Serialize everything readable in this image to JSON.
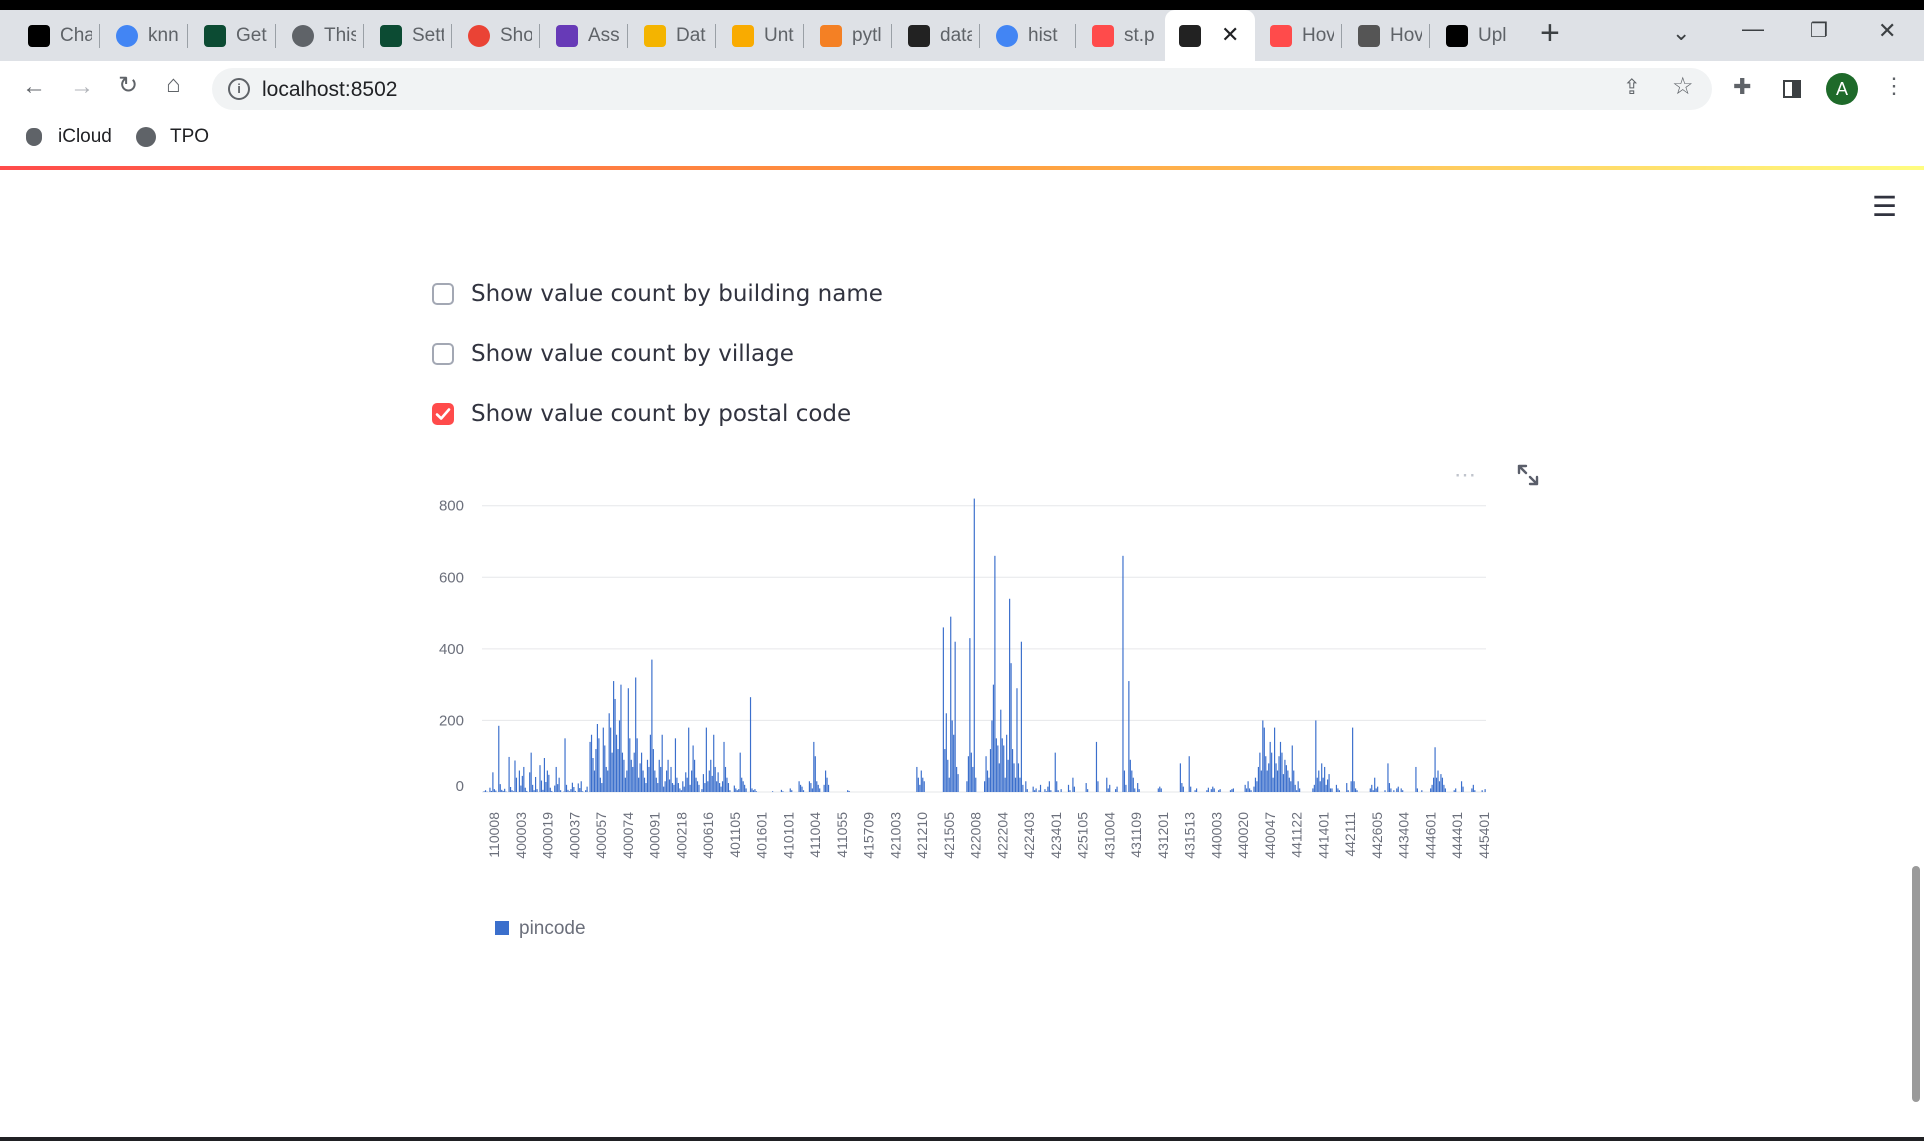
{
  "browser": {
    "tabs": [
      {
        "title": "Cha",
        "icon": "chatgpt-icon",
        "color": "#000000"
      },
      {
        "title": "knn",
        "icon": "google-icon",
        "color": "#4285f4"
      },
      {
        "title": "Get",
        "icon": "django-icon",
        "color": "#0c4b33"
      },
      {
        "title": "This",
        "icon": "globe-icon",
        "color": "#5f6368"
      },
      {
        "title": "Sett",
        "icon": "django-icon",
        "color": "#0c4b33"
      },
      {
        "title": "Sho",
        "icon": "gmail-icon",
        "color": "#ea4335"
      },
      {
        "title": "Ass",
        "icon": "forms-icon",
        "color": "#673ab7"
      },
      {
        "title": "Dat",
        "icon": "folder-icon",
        "color": "#f4b400"
      },
      {
        "title": "Unt",
        "icon": "colab-icon",
        "color": "#f9ab00"
      },
      {
        "title": "pytl",
        "icon": "stackoverflow-icon",
        "color": "#f48024"
      },
      {
        "title": "data",
        "icon": "streamlit-icon",
        "color": "#222222"
      },
      {
        "title": "hist",
        "icon": "google-icon",
        "color": "#4285f4"
      },
      {
        "title": "st.p",
        "icon": "streamlit-icon",
        "color": "#ff4b4b"
      },
      {
        "title": "",
        "icon": "streamlit-icon",
        "color": "#222222",
        "active": true
      },
      {
        "title": "Hov",
        "icon": "streamlit-icon",
        "color": "#ff4b4b"
      },
      {
        "title": "Hov",
        "icon": "avatar-icon",
        "color": "#555555"
      },
      {
        "title": "Upl",
        "icon": "github-icon",
        "color": "#000000"
      }
    ],
    "close_tab_glyph": "✕",
    "new_tab_glyph": "+",
    "url": "localhost:8502",
    "profile_initial": "A",
    "bookmarks": [
      {
        "label": "iCloud",
        "icon": "apple-icon"
      },
      {
        "label": "TPO",
        "icon": "globe-icon"
      }
    ]
  },
  "app": {
    "checkboxes": [
      {
        "label": "Show value count by building name",
        "checked": false
      },
      {
        "label": "Show value count by village",
        "checked": false
      },
      {
        "label": "Show value count by postal code",
        "checked": true
      }
    ],
    "menu_glyph": "☰"
  },
  "chart_data": {
    "type": "bar",
    "series_name": "pincode",
    "color": "#3b6fcc",
    "ylim": [
      0,
      830
    ],
    "yticks": [
      0,
      200,
      400,
      600,
      800
    ],
    "x_tick_labels": [
      "110008",
      "400003",
      "400019",
      "400037",
      "400057",
      "400074",
      "400091",
      "400218",
      "400616",
      "401105",
      "401601",
      "410101",
      "411004",
      "411055",
      "415709",
      "421003",
      "421210",
      "421505",
      "422008",
      "422204",
      "422403",
      "423401",
      "425105",
      "431004",
      "431109",
      "431201",
      "431513",
      "440003",
      "440020",
      "440047",
      "441122",
      "441401",
      "442111",
      "442605",
      "443404",
      "444601",
      "444401",
      "445401"
    ],
    "values": [
      0,
      2,
      5,
      1,
      0,
      12,
      3,
      55,
      8,
      4,
      0,
      185,
      22,
      6,
      3,
      9,
      1,
      0,
      98,
      14,
      5,
      2,
      88,
      40,
      0,
      60,
      18,
      45,
      70,
      12,
      3,
      0,
      55,
      110,
      20,
      5,
      42,
      8,
      0,
      75,
      32,
      6,
      95,
      28,
      60,
      48,
      12,
      3,
      0,
      18,
      70,
      22,
      40,
      5,
      0,
      1,
      150,
      20,
      6,
      2,
      8,
      26,
      14,
      3,
      0,
      24,
      11,
      30,
      2,
      0,
      5,
      15,
      0,
      140,
      160,
      95,
      60,
      120,
      190,
      150,
      40,
      25,
      180,
      130,
      70,
      60,
      220,
      180,
      110,
      310,
      260,
      160,
      120,
      200,
      300,
      110,
      90,
      40,
      60,
      290,
      150,
      90,
      70,
      110,
      320,
      150,
      40,
      80,
      110,
      60,
      40,
      25,
      90,
      70,
      160,
      370,
      120,
      60,
      40,
      25,
      90,
      70,
      160,
      15,
      30,
      60,
      90,
      35,
      70,
      25,
      20,
      150,
      40,
      25,
      10,
      5,
      30,
      15,
      55,
      40,
      180,
      20,
      60,
      130,
      90,
      40,
      30,
      20,
      0,
      8,
      50,
      25,
      180,
      30,
      60,
      90,
      45,
      160,
      70,
      30,
      55,
      25,
      15,
      30,
      140,
      70,
      40,
      25,
      5,
      0,
      0,
      18,
      10,
      5,
      8,
      110,
      40,
      30,
      20,
      10,
      0,
      0,
      265,
      10,
      5,
      8,
      2,
      0,
      0,
      0,
      0,
      0,
      0,
      0,
      0,
      0,
      0,
      2,
      0,
      0,
      0,
      0,
      0,
      6,
      2,
      0,
      0,
      0,
      0,
      10,
      5,
      0,
      0,
      0,
      0,
      30,
      20,
      15,
      5,
      0,
      0,
      0,
      30,
      25,
      10,
      140,
      100,
      30,
      20,
      10,
      0,
      0,
      20,
      60,
      40,
      20,
      0,
      0,
      0,
      0,
      0,
      0,
      0,
      0,
      0,
      0,
      0,
      0,
      5,
      3,
      0,
      0,
      0,
      0,
      0,
      0,
      0,
      0,
      0,
      0,
      0,
      0,
      0,
      0,
      0,
      0,
      0,
      0,
      0,
      0,
      0,
      0,
      0,
      0,
      0,
      0,
      0,
      0,
      0,
      0,
      0,
      0,
      0,
      0,
      0,
      0,
      0,
      0,
      0,
      0,
      0,
      0,
      0,
      0,
      0,
      70,
      40,
      20,
      60,
      40,
      30,
      0,
      0,
      0,
      0,
      0,
      0,
      0,
      0,
      0,
      0,
      0,
      0,
      460,
      120,
      220,
      90,
      40,
      490,
      200,
      160,
      420,
      70,
      50,
      0,
      0,
      0,
      0,
      0,
      30,
      100,
      430,
      110,
      70,
      820,
      40,
      0,
      0,
      0,
      0,
      0,
      30,
      100,
      60,
      40,
      120,
      200,
      300,
      660,
      150,
      130,
      80,
      230,
      150,
      130,
      40,
      160,
      90,
      540,
      360,
      120,
      80,
      40,
      290,
      80,
      40,
      420,
      20,
      0,
      30,
      8,
      0,
      0,
      0,
      15,
      5,
      10,
      0,
      5,
      20,
      0,
      0,
      8,
      2,
      15,
      30,
      5,
      0,
      0,
      110,
      30,
      5,
      0,
      8,
      0,
      0,
      0,
      0,
      20,
      5,
      0,
      40,
      15,
      0,
      0,
      0,
      0,
      0,
      0,
      0,
      25,
      8,
      0,
      0,
      0,
      0,
      0,
      140,
      30,
      0,
      0,
      0,
      0,
      0,
      40,
      10,
      20,
      0,
      0,
      0,
      8,
      15,
      0,
      0,
      0,
      660,
      60,
      20,
      0,
      310,
      90,
      60,
      40,
      10,
      0,
      25,
      8,
      0,
      0,
      0,
      0,
      0,
      0,
      0,
      0,
      0,
      0,
      0,
      0,
      10,
      15,
      10,
      0,
      0,
      0,
      0,
      0,
      0,
      0,
      0,
      0,
      0,
      0,
      0,
      80,
      25,
      15,
      0,
      0,
      0,
      100,
      15,
      0,
      0,
      5,
      10,
      0,
      0,
      0,
      0,
      0,
      0,
      5,
      12,
      0,
      8,
      15,
      10,
      0,
      0,
      5,
      8,
      0,
      0,
      0,
      0,
      0,
      0,
      5,
      8,
      10,
      0,
      0,
      0,
      0,
      0,
      0,
      0,
      20,
      10,
      30,
      10,
      5,
      0,
      15,
      40,
      30,
      70,
      110,
      60,
      200,
      180,
      100,
      60,
      80,
      140,
      110,
      40,
      180,
      80,
      60,
      100,
      140,
      110,
      50,
      90,
      75,
      60,
      40,
      30,
      130,
      60,
      20,
      5,
      30,
      10,
      0,
      0,
      0,
      0,
      0,
      0,
      0,
      0,
      10,
      20,
      200,
      40,
      60,
      30,
      80,
      40,
      70,
      20,
      35,
      50,
      10,
      10,
      0,
      0,
      20,
      10,
      5,
      0,
      0,
      0,
      0,
      25,
      5,
      0,
      30,
      180,
      30,
      10,
      5,
      0,
      0,
      0,
      0,
      0,
      0,
      0,
      0,
      10,
      20,
      5,
      40,
      10,
      15,
      0,
      0,
      0,
      0,
      5,
      0,
      80,
      25,
      10,
      0,
      5,
      0,
      10,
      15,
      0,
      10,
      5,
      0,
      0,
      0,
      0,
      0,
      0,
      0,
      0,
      70,
      10,
      0,
      0,
      5,
      0,
      0,
      0,
      0,
      0,
      10,
      20,
      40,
      125,
      40,
      60,
      30,
      50,
      40,
      20,
      10,
      0,
      0,
      0,
      0,
      0,
      5,
      10,
      0,
      0,
      0,
      30,
      15,
      0,
      0,
      0,
      0,
      0,
      10,
      20,
      5,
      0,
      0,
      0,
      0,
      5,
      0,
      8
    ]
  }
}
